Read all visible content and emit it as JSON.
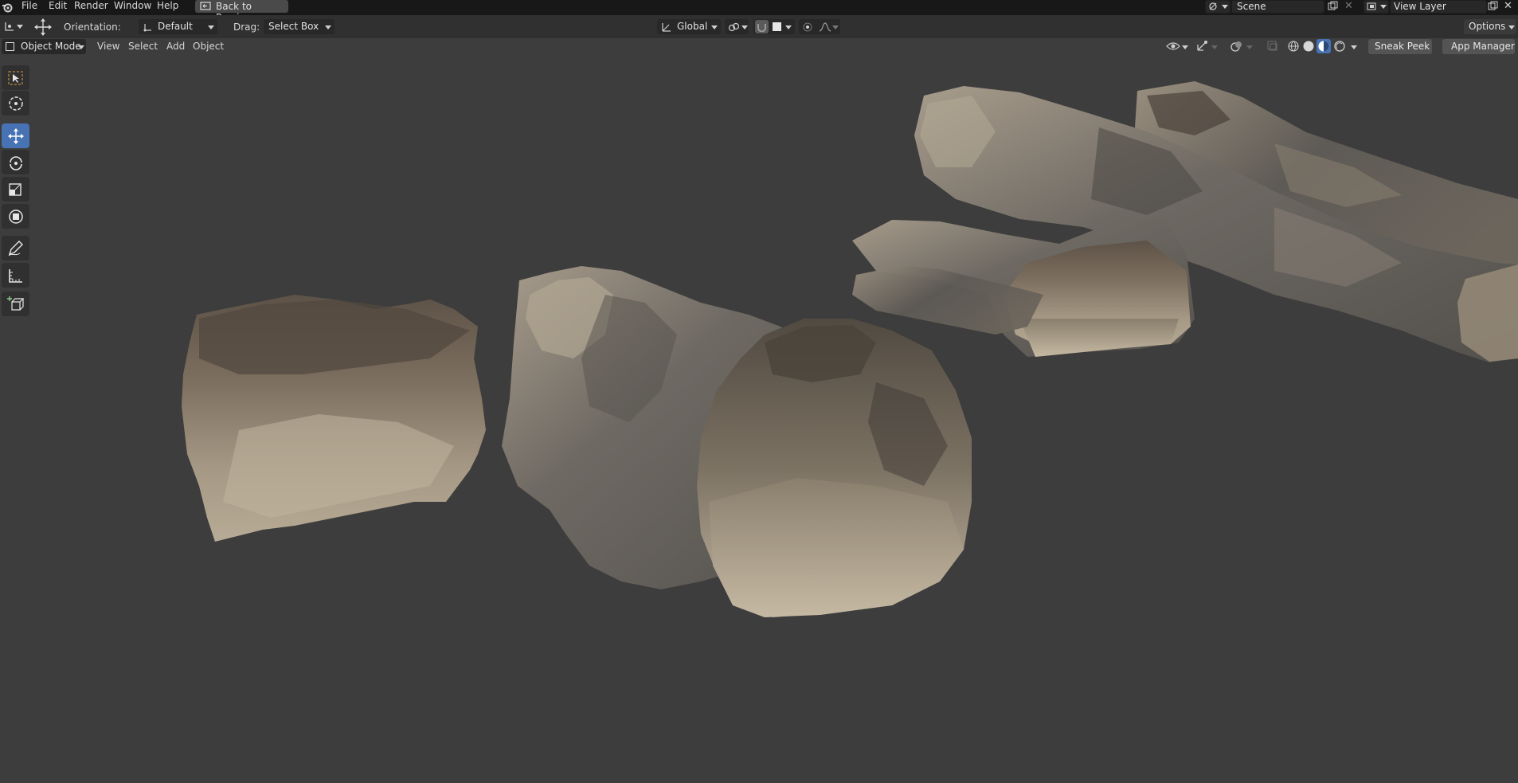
{
  "menu": {
    "items": [
      "File",
      "Edit",
      "Render",
      "Window",
      "Help"
    ],
    "back_label": "Back to Previous",
    "scene_label": "Scene",
    "view_layer_label": "View Layer"
  },
  "tool_header": {
    "orientation_label": "Orientation:",
    "orientation_value": "Default",
    "drag_label": "Drag:",
    "drag_value": "Select Box",
    "transform_space": "Global",
    "options_label": "Options"
  },
  "viewport_header": {
    "mode": "Object Mode",
    "menus": [
      "View",
      "Select",
      "Add",
      "Object"
    ],
    "sneak_peek_label": "Sneak Peek",
    "app_manager_label": "App Manager"
  },
  "toolbar": {
    "tools": [
      "select-box",
      "cursor",
      "move",
      "rotate",
      "scale",
      "transform",
      "annotate",
      "measure",
      "add-cube"
    ],
    "active": "move"
  },
  "colors": {
    "topbar": "#181818",
    "header": "#303030",
    "viewport": "#3d3d3d",
    "active_tool": "#4772b3",
    "rock_light": "#9a8d79",
    "rock_dark": "#4d4a45"
  }
}
